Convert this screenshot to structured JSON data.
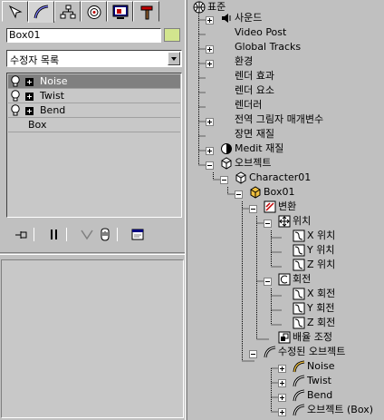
{
  "left_panel": {
    "tabs": [
      {
        "name": "create-tab",
        "icon": "create-arrow-icon",
        "active": false
      },
      {
        "name": "modify-tab",
        "icon": "modify-arc-icon",
        "active": true
      },
      {
        "name": "hierarchy-tab",
        "icon": "hierarchy-icon",
        "active": false
      },
      {
        "name": "motion-tab",
        "icon": "motion-icon",
        "active": false
      },
      {
        "name": "display-tab",
        "icon": "display-icon",
        "active": false
      },
      {
        "name": "utilities-tab",
        "icon": "hammer-icon",
        "active": false
      }
    ],
    "object_name": "Box01",
    "object_color": "#d2e58e",
    "modifier_list": {
      "selected": "수정자 목록"
    },
    "stack": [
      {
        "label": "Noise",
        "selected": true,
        "has_bulb": true,
        "has_plus": true
      },
      {
        "label": "Twist",
        "selected": false,
        "has_bulb": true,
        "has_plus": true
      },
      {
        "label": "Bend",
        "selected": false,
        "has_bulb": true,
        "has_plus": true
      },
      {
        "label": "Box",
        "selected": false,
        "has_bulb": false,
        "has_plus": false
      }
    ],
    "stack_tools": [
      "pin-stack-icon",
      "show-end-result-icon",
      "make-unique-icon",
      "remove-modifier-icon",
      "configure-modifier-sets-icon"
    ]
  },
  "tree": {
    "root": "표준",
    "nodes": [
      {
        "id": "sound",
        "label": "사운드"
      },
      {
        "id": "video-post",
        "label": "Video Post"
      },
      {
        "id": "global-tracks",
        "label": "Global Tracks"
      },
      {
        "id": "environment",
        "label": "환경"
      },
      {
        "id": "render-effects",
        "label": "렌더 효과"
      },
      {
        "id": "render-elements",
        "label": "렌더 요소"
      },
      {
        "id": "renderer",
        "label": "렌더러"
      },
      {
        "id": "global-shadow",
        "label": "전역 그림자 매개변수"
      },
      {
        "id": "scene-materials",
        "label": "장면 재질"
      },
      {
        "id": "medit-materials",
        "label": "Medit 재질"
      },
      {
        "id": "objects",
        "label": "오브젝트"
      },
      {
        "id": "character01",
        "label": "Character01"
      },
      {
        "id": "box01",
        "label": "Box01"
      },
      {
        "id": "transform",
        "label": "변환"
      },
      {
        "id": "position",
        "label": "위치"
      },
      {
        "id": "x-position",
        "label": "X 위치"
      },
      {
        "id": "y-position",
        "label": "Y 위치"
      },
      {
        "id": "z-position",
        "label": "Z 위치"
      },
      {
        "id": "rotation",
        "label": "회전"
      },
      {
        "id": "x-rotation",
        "label": "X 회전"
      },
      {
        "id": "y-rotation",
        "label": "Y 회전"
      },
      {
        "id": "z-rotation",
        "label": "Z 회전"
      },
      {
        "id": "scale",
        "label": "배율 조정"
      },
      {
        "id": "modified-object",
        "label": "수정된 오브젝트"
      },
      {
        "id": "noise",
        "label": "Noise"
      },
      {
        "id": "twist",
        "label": "Twist"
      },
      {
        "id": "bend",
        "label": "Bend"
      },
      {
        "id": "base-object",
        "label": "오브젝트 (Box)"
      }
    ]
  }
}
